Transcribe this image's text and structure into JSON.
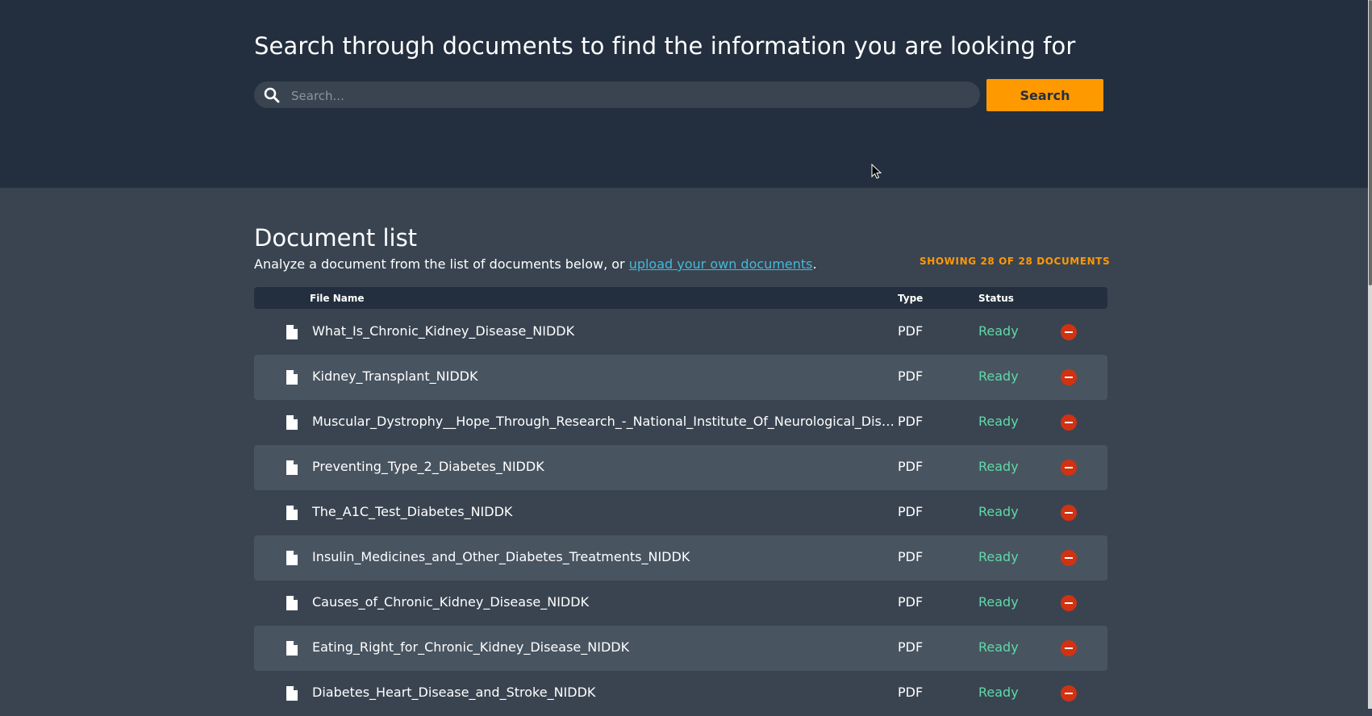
{
  "hero": {
    "title": "Search through documents to find the information you are looking for",
    "search_placeholder": "Search...",
    "search_button": "Search",
    "search_icon": "search-icon"
  },
  "documents": {
    "title": "Document list",
    "description_prefix": "Analyze a document from the list of documents below, or ",
    "upload_link": "upload your own documents",
    "description_suffix": ".",
    "count_label": "SHOWING 28 OF 28 DOCUMENTS",
    "columns": {
      "name": "File Name",
      "type": "Type",
      "status": "Status"
    },
    "rows": [
      {
        "name": "What_Is_Chronic_Kidney_Disease_NIDDK",
        "type": "PDF",
        "status": "Ready"
      },
      {
        "name": "Kidney_Transplant_NIDDK",
        "type": "PDF",
        "status": "Ready"
      },
      {
        "name": "Muscular_Dystrophy__Hope_Through_Research_-_National_Institute_Of_Neurological_Disorders…",
        "type": "PDF",
        "status": "Ready"
      },
      {
        "name": "Preventing_Type_2_Diabetes_NIDDK",
        "type": "PDF",
        "status": "Ready"
      },
      {
        "name": "The_A1C_Test_Diabetes_NIDDK",
        "type": "PDF",
        "status": "Ready"
      },
      {
        "name": "Insulin_Medicines_and_Other_Diabetes_Treatments_NIDDK",
        "type": "PDF",
        "status": "Ready"
      },
      {
        "name": "Causes_of_Chronic_Kidney_Disease_NIDDK",
        "type": "PDF",
        "status": "Ready"
      },
      {
        "name": "Eating_Right_for_Chronic_Kidney_Disease_NIDDK",
        "type": "PDF",
        "status": "Ready"
      },
      {
        "name": "Diabetes_Heart_Disease_and_Stroke_NIDDK",
        "type": "PDF",
        "status": "Ready"
      }
    ]
  },
  "colors": {
    "header_bg": "#232f3e",
    "page_bg": "#3a4451",
    "accent": "#ff9900",
    "status_ready": "#5fd9a6",
    "remove": "#d13212",
    "link": "#44b9d6"
  }
}
